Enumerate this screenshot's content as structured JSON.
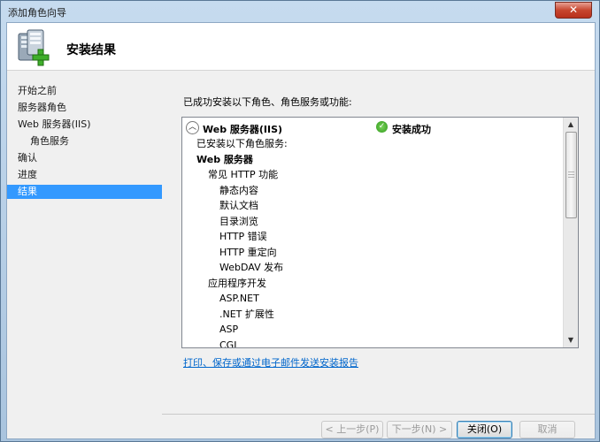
{
  "window": {
    "title": "添加角色向导",
    "close_symbol": "✕"
  },
  "header": {
    "title": "安装结果",
    "icon": "server-add-icon"
  },
  "nav": {
    "items": [
      {
        "label": "开始之前",
        "sub": false,
        "active": false
      },
      {
        "label": "服务器角色",
        "sub": false,
        "active": false
      },
      {
        "label": "Web 服务器(IIS)",
        "sub": false,
        "active": false
      },
      {
        "label": "角色服务",
        "sub": true,
        "active": false
      },
      {
        "label": "确认",
        "sub": false,
        "active": false
      },
      {
        "label": "进度",
        "sub": false,
        "active": false
      },
      {
        "label": "结果",
        "sub": false,
        "active": true
      }
    ]
  },
  "main": {
    "intro": "已成功安装以下角色、角色服务或功能:",
    "result": {
      "role_name": "Web 服务器(IIS)",
      "status": "安装成功",
      "details": [
        {
          "text": "已安装以下角色服务:",
          "level": 0,
          "bold": false
        },
        {
          "text": "Web 服务器",
          "level": 0,
          "bold": true
        },
        {
          "text": "常见 HTTP 功能",
          "level": 1,
          "bold": false
        },
        {
          "text": "静态内容",
          "level": 2,
          "bold": false
        },
        {
          "text": "默认文档",
          "level": 2,
          "bold": false
        },
        {
          "text": "目录浏览",
          "level": 2,
          "bold": false
        },
        {
          "text": "HTTP 错误",
          "level": 2,
          "bold": false
        },
        {
          "text": "HTTP 重定向",
          "level": 2,
          "bold": false
        },
        {
          "text": "WebDAV 发布",
          "level": 2,
          "bold": false
        },
        {
          "text": "应用程序开发",
          "level": 1,
          "bold": false
        },
        {
          "text": "ASP.NET",
          "level": 2,
          "bold": false
        },
        {
          "text": ".NET 扩展性",
          "level": 2,
          "bold": false
        },
        {
          "text": "ASP",
          "level": 2,
          "bold": false
        },
        {
          "text": "CGI",
          "level": 2,
          "bold": false
        }
      ]
    },
    "report_link": "打印、保存或通过电子邮件发送安装报告"
  },
  "footer": {
    "prev": "< 上一步(P)",
    "next": "下一步(N) >",
    "close": "关闭(O)",
    "cancel": "取消"
  }
}
